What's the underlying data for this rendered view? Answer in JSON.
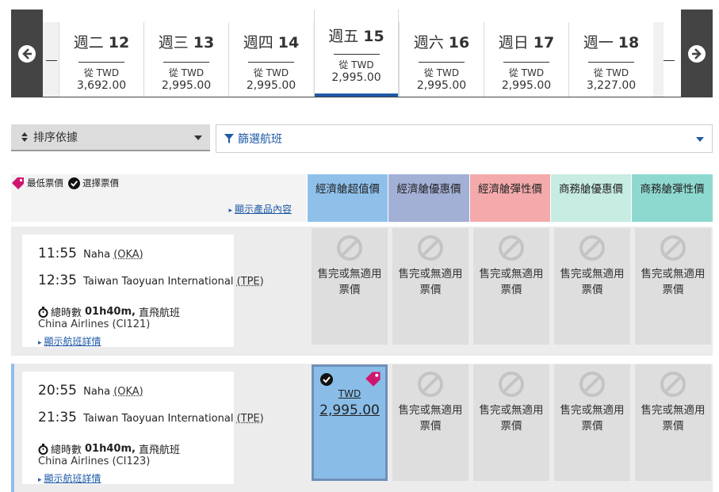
{
  "dates": [
    {
      "weekday": "週二",
      "day": "12",
      "from_label": "從 TWD",
      "price": "3,692.00",
      "active": false
    },
    {
      "weekday": "週三",
      "day": "13",
      "from_label": "從 TWD",
      "price": "2,995.00",
      "active": false
    },
    {
      "weekday": "週四",
      "day": "14",
      "from_label": "從 TWD",
      "price": "2,995.00",
      "active": false
    },
    {
      "weekday": "週五",
      "day": "15",
      "from_label": "從 TWD",
      "price": "2,995.00",
      "active": true
    },
    {
      "weekday": "週六",
      "day": "16",
      "from_label": "從 TWD",
      "price": "2,995.00",
      "active": false
    },
    {
      "weekday": "週日",
      "day": "17",
      "from_label": "從 TWD",
      "price": "2,995.00",
      "active": false
    },
    {
      "weekday": "週一",
      "day": "18",
      "from_label": "從 TWD",
      "price": "3,227.00",
      "active": false
    }
  ],
  "sort": {
    "label": "排序依據"
  },
  "filter": {
    "label": "篩選航班"
  },
  "legend": {
    "lowest": "最低票價",
    "selected": "選擇票價",
    "show_product": "顯示產品內容"
  },
  "fare_columns": [
    {
      "label": "經濟艙超值價",
      "color": "#8fc0ea"
    },
    {
      "label": "經濟艙優惠價",
      "color": "#a3b0d6"
    },
    {
      "label": "經濟艙彈性價",
      "color": "#f4aaaa"
    },
    {
      "label": "商務艙優惠價",
      "color": "#c7ece2"
    },
    {
      "label": "商務艙彈性價",
      "color": "#8ed9cf"
    }
  ],
  "unavailable_text": "售完或無適用票價",
  "flights": [
    {
      "dep_time": "11:55",
      "dep_city": "Naha",
      "dep_code": "(OKA)",
      "arr_time": "12:35",
      "arr_city": "Taiwan Taoyuan International",
      "arr_code": "(TPE)",
      "duration_label": "總時數",
      "duration": "01h40m,",
      "stops": "直飛航班",
      "airline": "China Airlines (CI121)",
      "details_label": "顯示航班詳情",
      "fares": [
        null,
        null,
        null,
        null,
        null
      ]
    },
    {
      "dep_time": "20:55",
      "dep_city": "Naha",
      "dep_code": "(OKA)",
      "arr_time": "21:35",
      "arr_city": "Taiwan Taoyuan International",
      "arr_code": "(TPE)",
      "duration_label": "總時數",
      "duration": "01h40m,",
      "stops": "直飛航班",
      "airline": "China Airlines (CI123)",
      "details_label": "顯示航班詳情",
      "fares": [
        {
          "currency": "TWD",
          "amount": "2,995.00"
        },
        null,
        null,
        null,
        null
      ]
    }
  ]
}
